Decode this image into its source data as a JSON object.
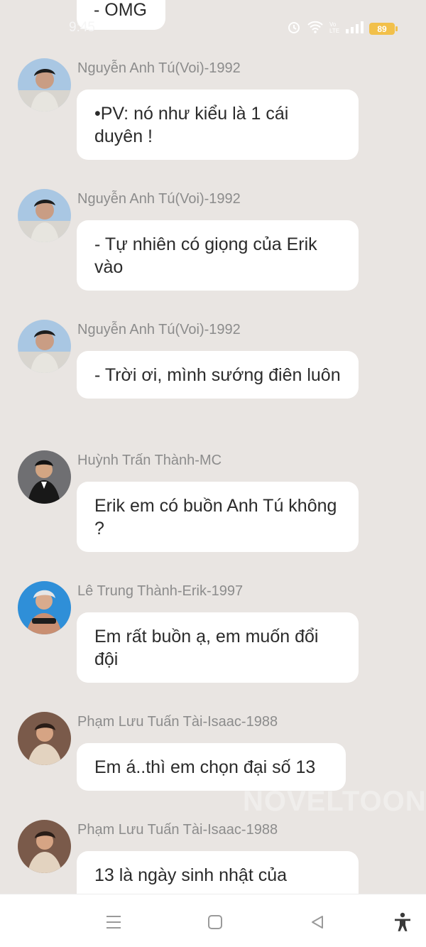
{
  "status_bar": {
    "time": "9:45",
    "battery": "89"
  },
  "top_partial_message": {
    "text": "- OMG"
  },
  "messages": [
    {
      "sender": "Nguyễn Anh Tú(Voi)-1992",
      "text": "•PV: nó như kiểu là 1 cái duyên !",
      "avatar": "avatar-tu"
    },
    {
      "sender": "Nguyễn Anh Tú(Voi)-1992",
      "text": "- Tự nhiên có giọng của Erik vào",
      "avatar": "avatar-tu"
    },
    {
      "sender": "Nguyễn Anh Tú(Voi)-1992",
      "text": "- Trời ơi, mình sướng điên luôn",
      "avatar": "avatar-tu"
    },
    {
      "sender": "Huỳnh Trấn Thành-MC",
      "text": "Erik em có buồn Anh Tú không ?",
      "avatar": "avatar-thanh"
    },
    {
      "sender": "Lê Trung Thành-Erik-1997",
      "text": "Em rất buồn ạ, em muốn đổi đội",
      "avatar": "avatar-erik"
    },
    {
      "sender": "Phạm Lưu Tuấn Tài-Isaac-1988",
      "text": "Em á..thì em chọn đại số 13",
      "avatar": "avatar-isaac"
    },
    {
      "sender": "Phạm Lưu Tuấn Tài-Isaac-1988",
      "text": "13 là ngày sinh nhật của",
      "avatar": "avatar-isaac"
    }
  ],
  "watermark": "NOVELTOON",
  "nav": {
    "menu": "menu-icon",
    "home": "home-icon",
    "back": "back-icon",
    "accessibility": "accessibility-icon"
  },
  "colors": {
    "background": "#e9e5e2",
    "bubble": "#ffffff",
    "name": "#8c8c8c",
    "battery": "#f2c04a"
  }
}
